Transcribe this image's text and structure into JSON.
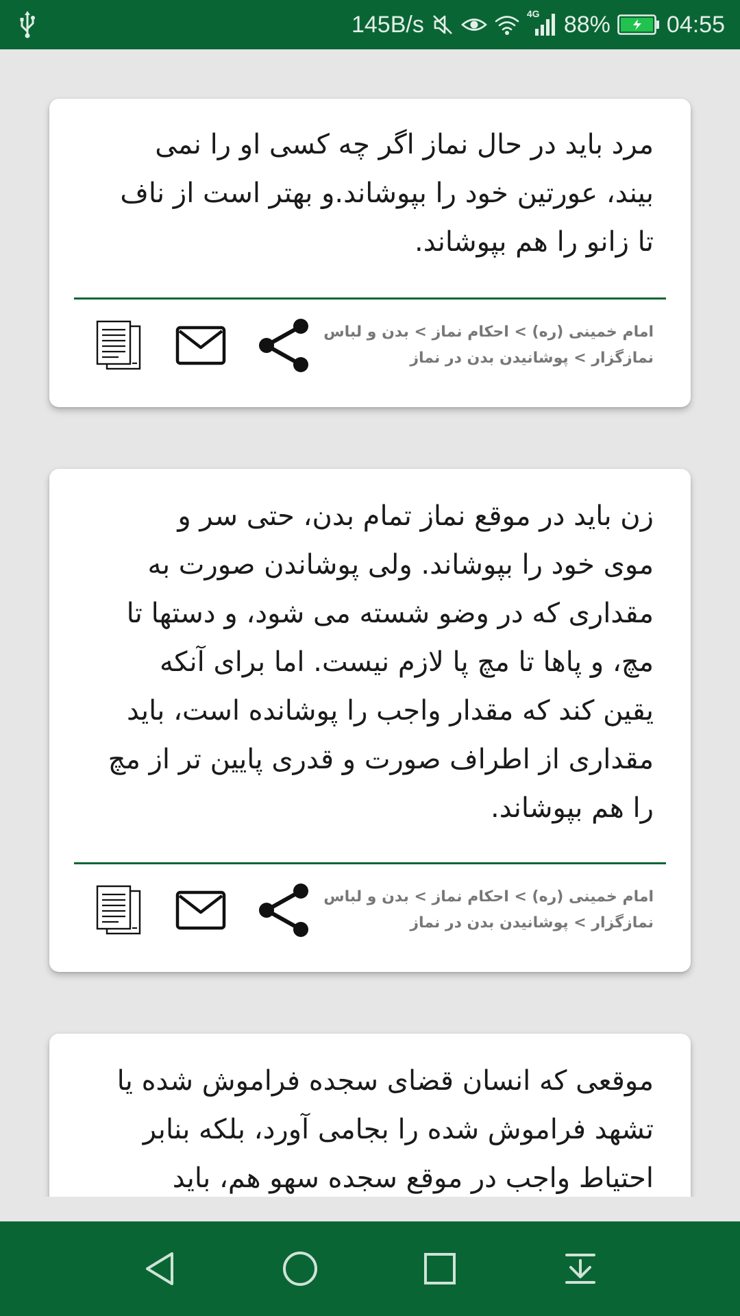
{
  "status_bar": {
    "speed": "145B/s",
    "network_badge": "4G",
    "battery": "88%",
    "time": "04:55",
    "icons": [
      "usb-icon",
      "mute-icon",
      "eye-icon",
      "wifi-icon",
      "signal-icon",
      "battery-icon"
    ]
  },
  "cards": [
    {
      "text": "مرد باید در حال نماز اگر چه کسی او را نمی\nبیند، عورتین خود را بپوشاند.و بهتر است از ناف\nتا زانو را هم بپوشاند.",
      "breadcrumb": "امام خمینی (ره) > احکام نماز > بدن و لباس\nنمازگزار > پوشانیدن بدن در نماز"
    },
    {
      "text": "زن باید در موقع نماز تمام بدن، حتی سر و\nموی خود را بپوشاند. ولی پوشاندن صورت به\nمقداری که در وضو شسته می شود، و دستها تا\nمچ، و پاها تا مچ پا لازم نیست. اما برای آنکه\nیقین کند که مقدار واجب را پوشانده است، باید\nمقداری از اطراف صورت و قدری پایین تر از مچ\nرا هم بپوشاند.",
      "breadcrumb": "امام خمینی (ره) > احکام نماز > بدن و لباس\nنمازگزار > پوشانیدن بدن در نماز"
    },
    {
      "text": "موقعی که انسان قضای سجده فراموش شده یا\nتشهد فراموش شده را بجامی آورد، بلکه بنابر\nاحتیاط واجب در موقع سجده سهو هم، باید"
    }
  ],
  "card_actions": [
    "copy-icon",
    "email-icon",
    "share-icon"
  ],
  "nav_bar": {
    "buttons": [
      "back-icon",
      "home-icon",
      "recents-icon",
      "notification-pull-icon"
    ]
  },
  "colors": {
    "primary": "#0a6535",
    "background": "#e6e6e6",
    "card": "#ffffff",
    "breadcrumb_text": "#777777"
  }
}
